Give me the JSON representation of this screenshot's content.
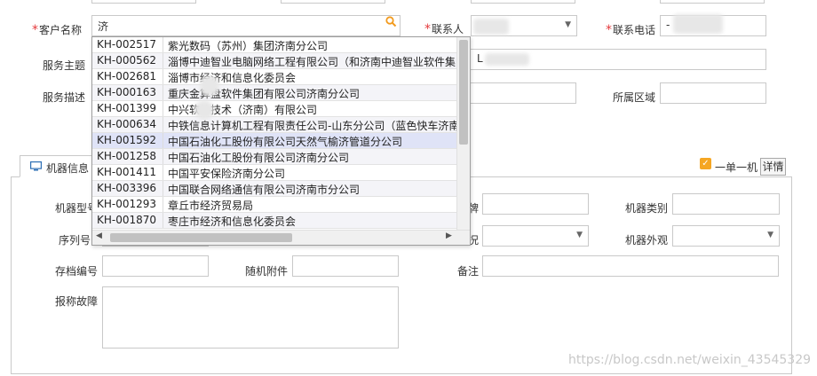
{
  "top_form": {
    "customer": {
      "label": "客户名称",
      "value": "济",
      "required": true
    },
    "contact": {
      "label": "联系人",
      "required": true
    },
    "phone": {
      "label": "联系电话",
      "required": true,
      "value": "-"
    },
    "service_subject": {
      "label": "服务主题",
      "value": "L"
    },
    "service_desc": {
      "label": "服务描述"
    },
    "region": {
      "label": "所属区域"
    }
  },
  "autocomplete": {
    "items": [
      {
        "code": "KH-002517",
        "name": "紫光数码（苏州）集团济南分公司"
      },
      {
        "code": "KH-000562",
        "name": "淄博中迪智业电脑网络工程有限公司（和济南中迪智业软件集"
      },
      {
        "code": "KH-002681",
        "name": "淄博市经济和信息化委员会"
      },
      {
        "code": "KH-000163",
        "name": "重庆金算盘软件集团有限公司济南分公司"
      },
      {
        "code": "KH-001399",
        "name": "中兴软件技术（济南）有限公司"
      },
      {
        "code": "KH-000634",
        "name": "中铁信息计算机工程有限责任公司-山东分公司（蓝色快车济南"
      },
      {
        "code": "KH-001592",
        "name": "中国石油化工股份有限公司天然气榆济管道分公司"
      },
      {
        "code": "KH-001258",
        "name": "中国石油化工股份有限公司济南分公司"
      },
      {
        "code": "KH-001411",
        "name": "中国平安保险济南分公司"
      },
      {
        "code": "KH-003396",
        "name": "中国联合网络通信有限公司济南市分公司"
      },
      {
        "code": "KH-001293",
        "name": "章丘市经济贸易局"
      },
      {
        "code": "KH-001870",
        "name": "枣庄市经济和信息化委员会"
      }
    ],
    "highlighted_index": 6
  },
  "tab": {
    "label": "机器信息"
  },
  "single_machine": {
    "label": "一单一机",
    "checked": true
  },
  "detail_button": {
    "label": "详情"
  },
  "machine_form": {
    "machine_model": {
      "label": "机器型号"
    },
    "brand": {
      "label": "品牌"
    },
    "machine_category": {
      "label": "机器类别"
    },
    "serial_no": {
      "label": "序列号"
    },
    "status": {
      "label": "状况"
    },
    "machine_appearance": {
      "label": "机器外观"
    },
    "archive_no": {
      "label": "存档编号"
    },
    "accessories": {
      "label": "随机附件"
    },
    "remarks": {
      "label": "备注"
    },
    "reported_fault": {
      "label": "报称故障"
    }
  },
  "watermark": "https://blog.csdn.net/weixin_43545329",
  "colors": {
    "required": "#e4393c",
    "checkbox": "#f5a623",
    "highlight_row": "#dfe3f7",
    "search_icon": "#f29a1d"
  },
  "icons": {
    "search": "search-icon",
    "dropdown": "triangle-down-icon",
    "tab": "monitor-icon"
  }
}
